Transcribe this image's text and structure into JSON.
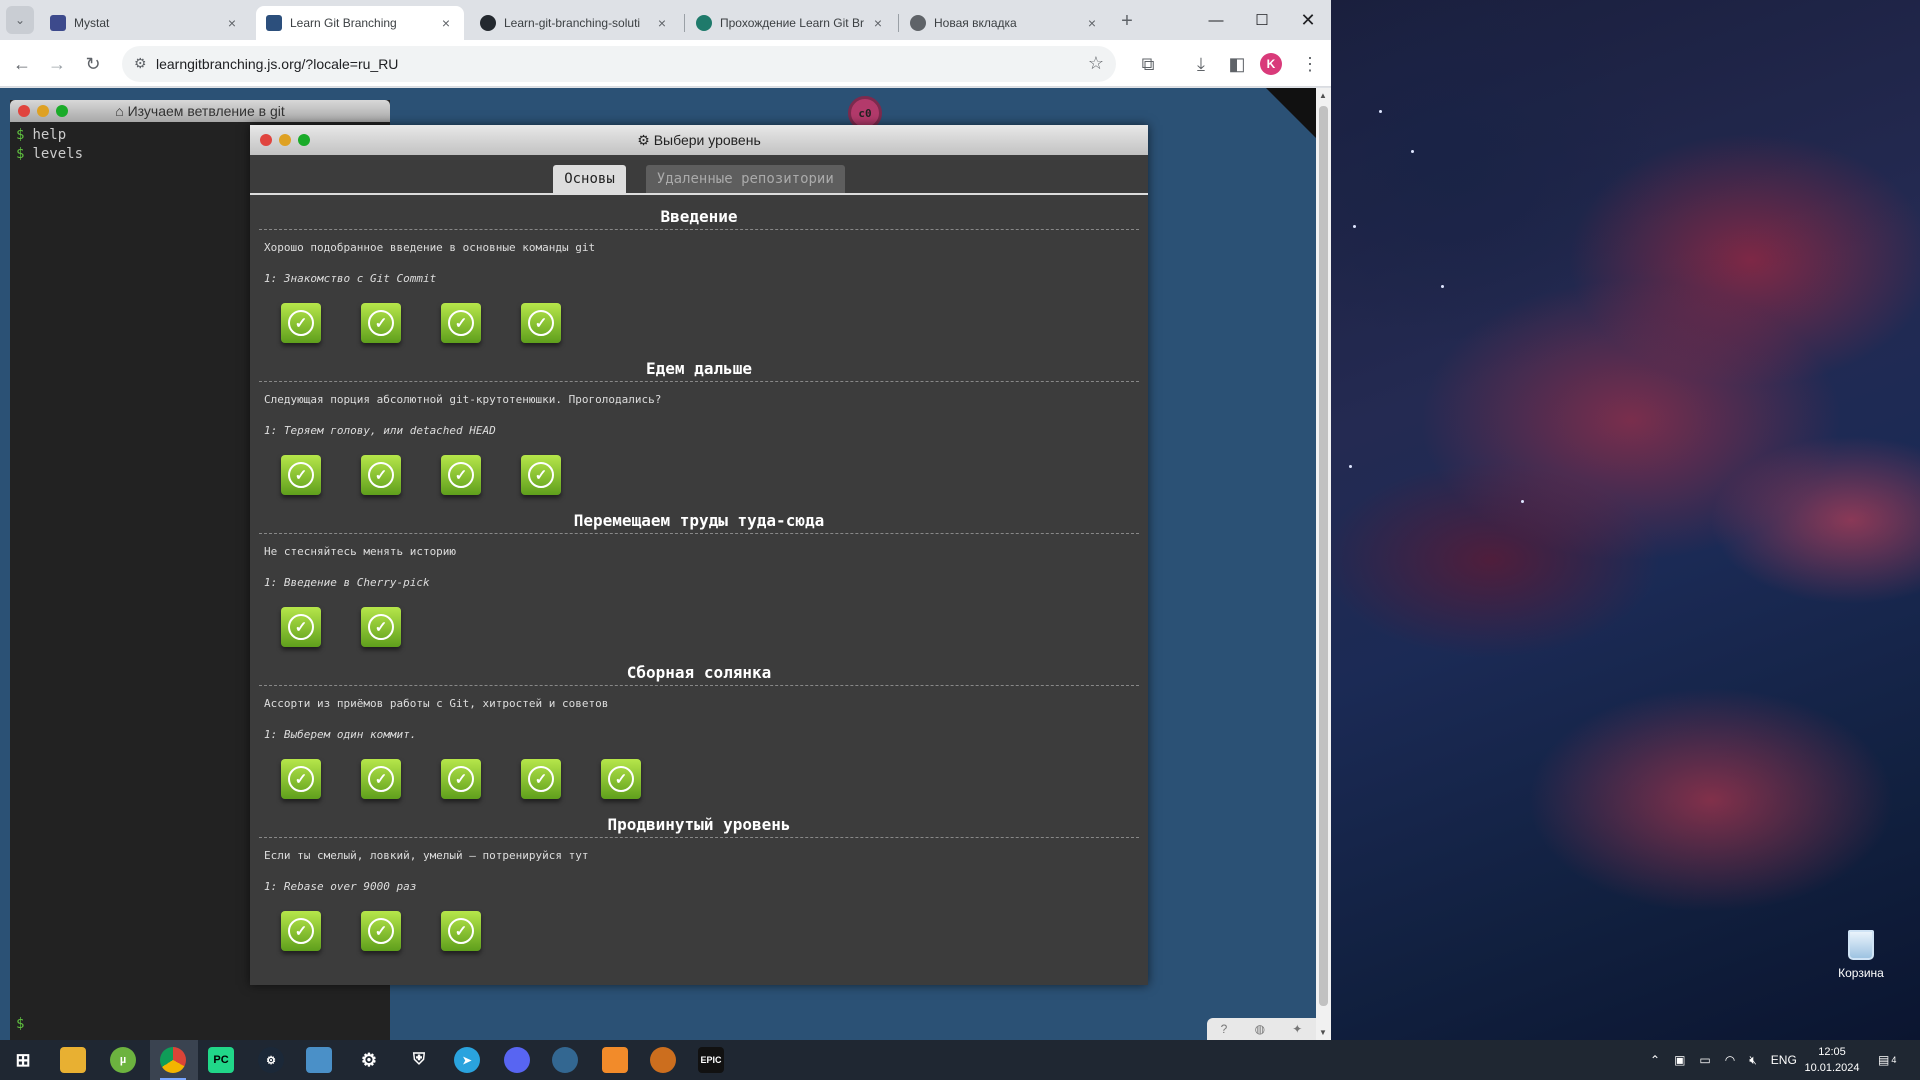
{
  "browser": {
    "tabs": [
      {
        "title": "Mystat",
        "active": false,
        "favicon_color": "#3d4a8c"
      },
      {
        "title": "Learn Git Branching",
        "active": true,
        "favicon_color": "#2c4f7c"
      },
      {
        "title": "Learn-git-branching-soluti",
        "active": false,
        "favicon_color": "#24292f"
      },
      {
        "title": "Прохождение Learn Git Br",
        "active": false,
        "favicon_color": "#1f7a6b"
      },
      {
        "title": "Новая вкладка",
        "active": false,
        "favicon_color": "#5f6368"
      }
    ],
    "url": "learngitbranching.js.org/?locale=ru_RU",
    "profile_initial": "K"
  },
  "terminal": {
    "title": "Изучаем ветвление в git",
    "lines": [
      "help",
      "levels"
    ],
    "prompt": "$",
    "line_prompt": "$"
  },
  "badge": "c0",
  "dialog": {
    "title": "Выбери уровень",
    "tabs": [
      {
        "label": "Основы",
        "active": true
      },
      {
        "label": "Удаленные репозитории",
        "active": false
      }
    ],
    "sequences": [
      {
        "title": "Введение",
        "description": "Хорошо подобранное введение в основные команды git",
        "level": "1: Знакомство с Git Commit",
        "completed": 4
      },
      {
        "title": "Едем дальше",
        "description": "Следующая порция абсолютной git-крутотенюшки. Проголодались?",
        "level": "1: Теряем голову, или detached HEAD",
        "completed": 4
      },
      {
        "title": "Перемещаем труды туда-сюда",
        "description": "Не стесняйтесь менять историю",
        "level": "1: Введение в Cherry-pick",
        "completed": 2
      },
      {
        "title": "Сборная солянка",
        "description": "Ассорти из приёмов работы с Git, хитростей и советов",
        "level": "1: Выберем один коммит.",
        "completed": 5
      },
      {
        "title": "Продвинутый уровень",
        "description": "Если ты смелый, ловкий, умелый – потренируйся тут",
        "level": "1: Rebase over 9000 раз",
        "completed": 3
      }
    ]
  },
  "desktop": {
    "recycle_bin_label": "Корзина"
  },
  "taskbar": {
    "apps": [
      "start-icon",
      "explorer-icon",
      "utorrent-icon",
      "chrome-icon",
      "pycharm-icon",
      "steam-icon",
      "app-icon",
      "settings-icon",
      "security-icon",
      "telegram-icon",
      "discord-icon",
      "postgres-icon",
      "sublime-icon",
      "gear-app-icon",
      "epic-games-icon"
    ],
    "language": "ENG",
    "time": "12:05",
    "date": "10.01.2024",
    "notifications": "4"
  },
  "colors": {
    "page_bg": "#2b5175",
    "dialog_bg": "#3c3c3c",
    "level_complete": "#7cc02a"
  }
}
